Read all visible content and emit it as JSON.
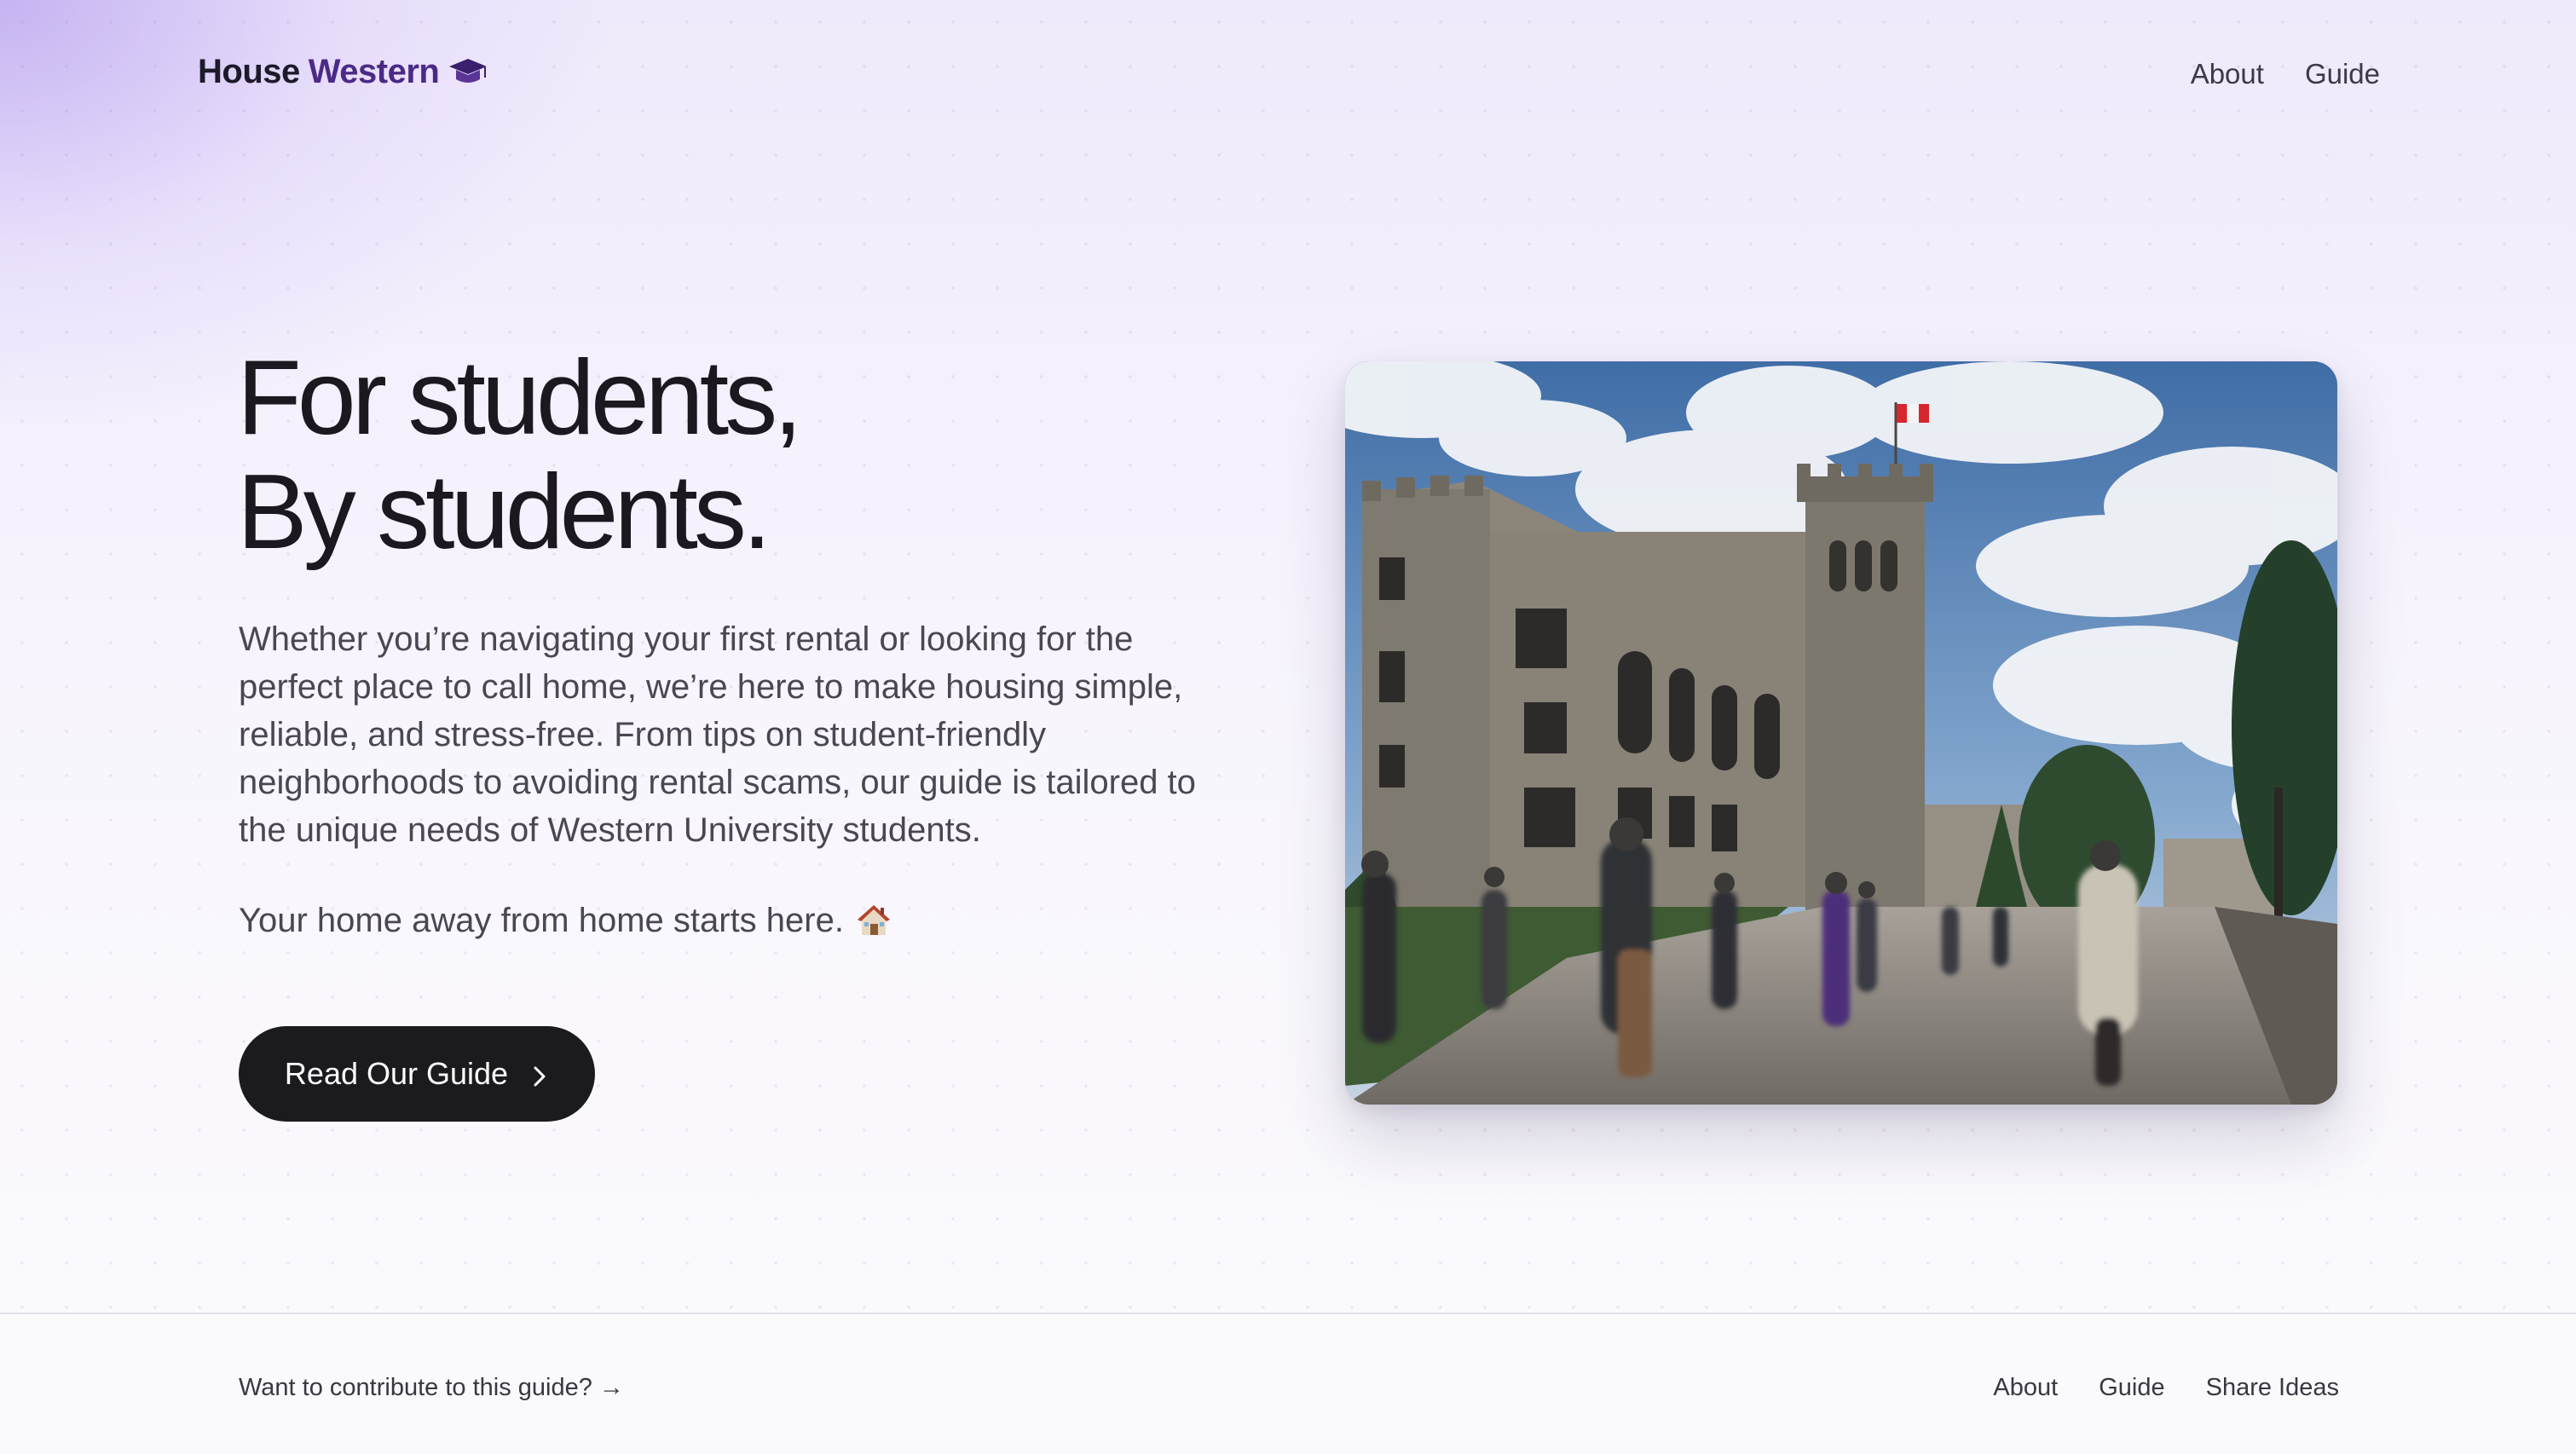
{
  "header": {
    "logo_part1": "House",
    "logo_part2": "Western",
    "logo_icon": "graduation-cap-icon",
    "nav": [
      {
        "label": "About"
      },
      {
        "label": "Guide"
      }
    ]
  },
  "hero": {
    "headline_line1": "For students,",
    "headline_line2": "By students.",
    "intro": "Whether you’re navigating your first rental or looking for the perfect place to call home, we’re here to make housing simple, reliable, and stress-free. From tips on student-friendly neighborhoods to avoiding rental scams, our guide is tailored to the unique needs of Western University students.",
    "tagline": "Your home away from home starts here.",
    "tagline_icon": "house-icon",
    "cta_label": "Read Our Guide",
    "cta_icon": "chevron-right-icon"
  },
  "footer": {
    "contribute": "Want to contribute to this guide? →",
    "links": [
      {
        "label": "About"
      },
      {
        "label": "Guide"
      },
      {
        "label": "Share Ideas"
      }
    ]
  },
  "colors": {
    "brand_purple": "#4b2a86",
    "cta_background": "#1b1a1d",
    "text_dark": "#1b1820",
    "text_body": "#4a4752"
  }
}
